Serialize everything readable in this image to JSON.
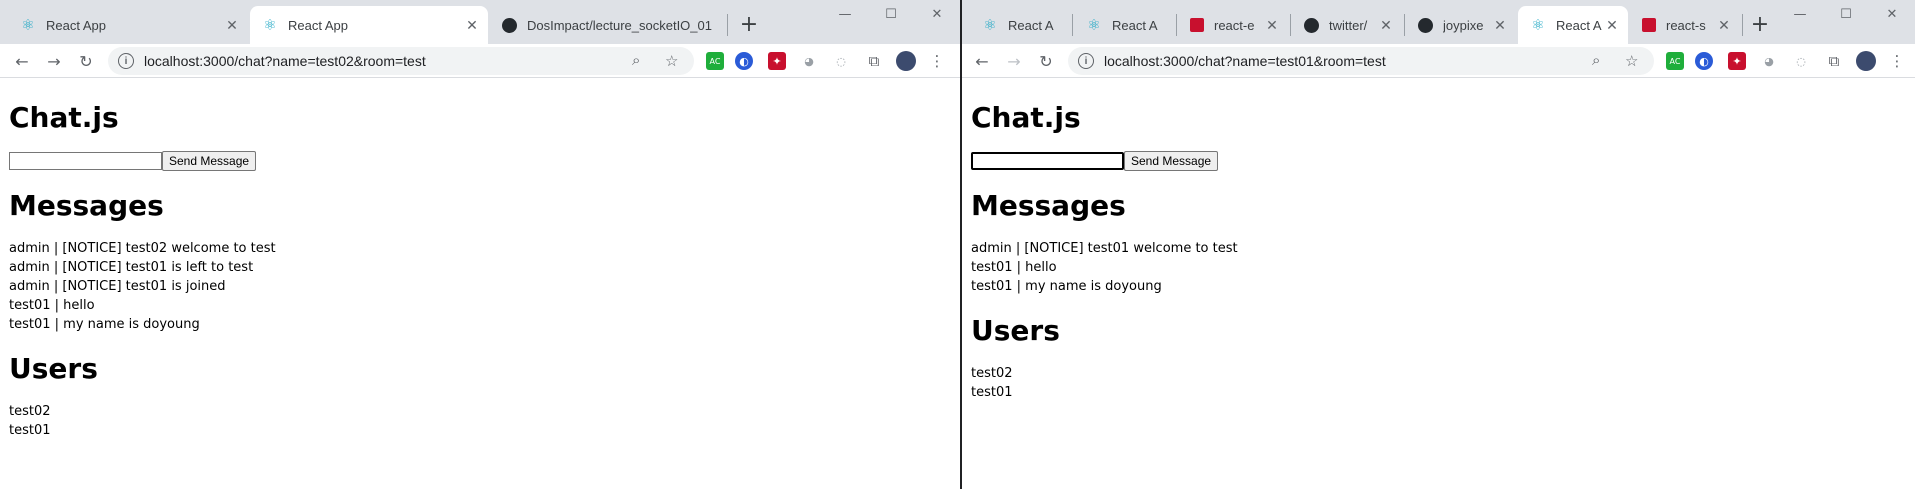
{
  "left": {
    "tabs": [
      {
        "title": "React App",
        "favicon": "react-icon",
        "active": false
      },
      {
        "title": "React App",
        "favicon": "react-icon",
        "active": true
      },
      {
        "title": "DosImpact/lecture_socketIO_01",
        "favicon": "github-icon",
        "active": false
      }
    ],
    "url": "localhost:3000/chat?name=test02&room=test",
    "page": {
      "title": "Chat.js",
      "input_value": "",
      "send_label": "Send Message",
      "messages_heading": "Messages",
      "messages": [
        "admin | [NOTICE] test02 welcome to test",
        "admin | [NOTICE] test01 is left to test",
        "admin | [NOTICE] test01 is joined",
        "test01 | hello",
        "test01 | my name is doyoung"
      ],
      "users_heading": "Users",
      "users": [
        "test02",
        "test01"
      ]
    }
  },
  "right": {
    "tabs": [
      {
        "title": "React A",
        "favicon": "react-icon",
        "active": false
      },
      {
        "title": "React A",
        "favicon": "react-icon",
        "active": false
      },
      {
        "title": "react-e",
        "favicon": "npm-icon",
        "active": false
      },
      {
        "title": "twitter/",
        "favicon": "github-icon",
        "active": false
      },
      {
        "title": "joypixe",
        "favicon": "github-icon",
        "active": false
      },
      {
        "title": "React A",
        "favicon": "react-icon",
        "active": true
      },
      {
        "title": "react-s",
        "favicon": "npm-icon",
        "active": false
      }
    ],
    "url": "localhost:3000/chat?name=test01&room=test",
    "page": {
      "title": "Chat.js",
      "input_value": "",
      "send_label": "Send Message",
      "messages_heading": "Messages",
      "messages": [
        "admin | [NOTICE] test01 welcome to test",
        "test01 | hello",
        "test01 | my name is doyoung"
      ],
      "users_heading": "Users",
      "users": [
        "test02",
        "test01"
      ]
    }
  },
  "colors": {
    "tabbar_bg": "#dee1e6",
    "omnibox_bg": "#f1f3f4",
    "react_accent": "#1ea7c4"
  }
}
